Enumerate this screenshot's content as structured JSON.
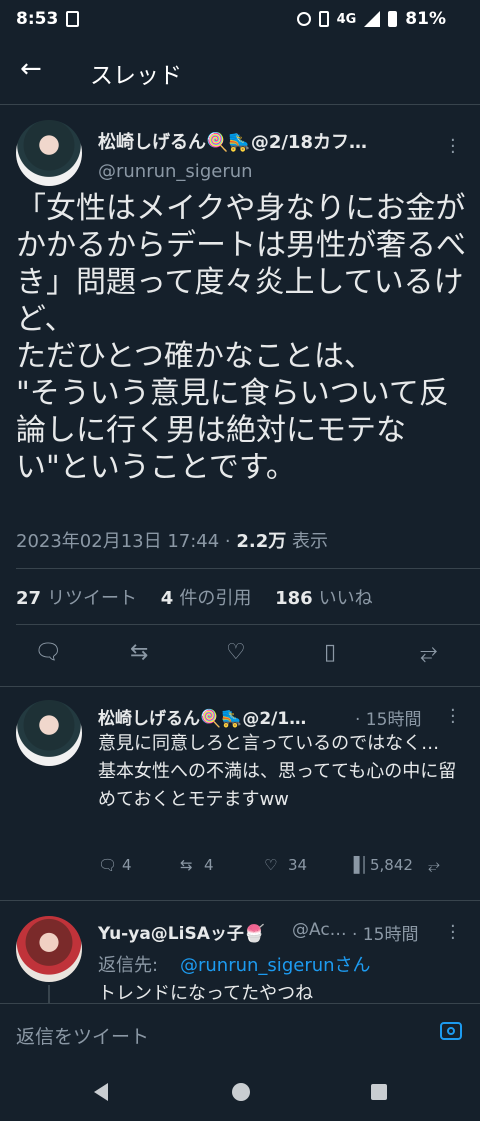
{
  "status_bar": {
    "time": "8:53",
    "network": "4G",
    "battery": "81%"
  },
  "header": {
    "title": "スレッド"
  },
  "tweet": {
    "display_name": "松崎しげるん🍭🛼@2/18カフ…",
    "handle": "@runrun_sigerun",
    "text": "「女性はメイクや身なりにお金がかかるからデートは男性が奢るべき」問題って度々炎上しているけど、\nただひとつ確かなことは、\n\"そういう意見に食らいついて反論しに行く男は絶対にモテない\"ということです。",
    "timestamp": "2023年02月13日 17:44 ·",
    "views_count": "2.2万",
    "views_label": "表示",
    "retweets_count": "27",
    "retweets_label": "リツイート",
    "quotes_count": "4",
    "quotes_label": "件の引用",
    "likes_count": "186",
    "likes_label": "いいね"
  },
  "reply1": {
    "display_name": "松崎しげるん🍭🛼@2/1…",
    "time": "· 15時間",
    "text": "意見に同意しろと言っているのではなく…\n基本女性への不満は、思ってても心の中に留めておくとモテますww",
    "replies": "4",
    "retweets": "4",
    "likes": "34",
    "views": "5,842"
  },
  "reply2": {
    "display_name": "Yu-ya@LiSAッ子🍧",
    "handle": "@Ac…",
    "time": "· 15時間",
    "reply_to_label": "返信先:",
    "reply_to_handle": "@runrun_sigerunさん",
    "text": "トレンドになってたやつね"
  },
  "compose": {
    "placeholder": "返信をツイート"
  },
  "colors": {
    "background": "#15202b",
    "accent": "#1d9bf0",
    "secondary_text": "#8b98a5"
  }
}
